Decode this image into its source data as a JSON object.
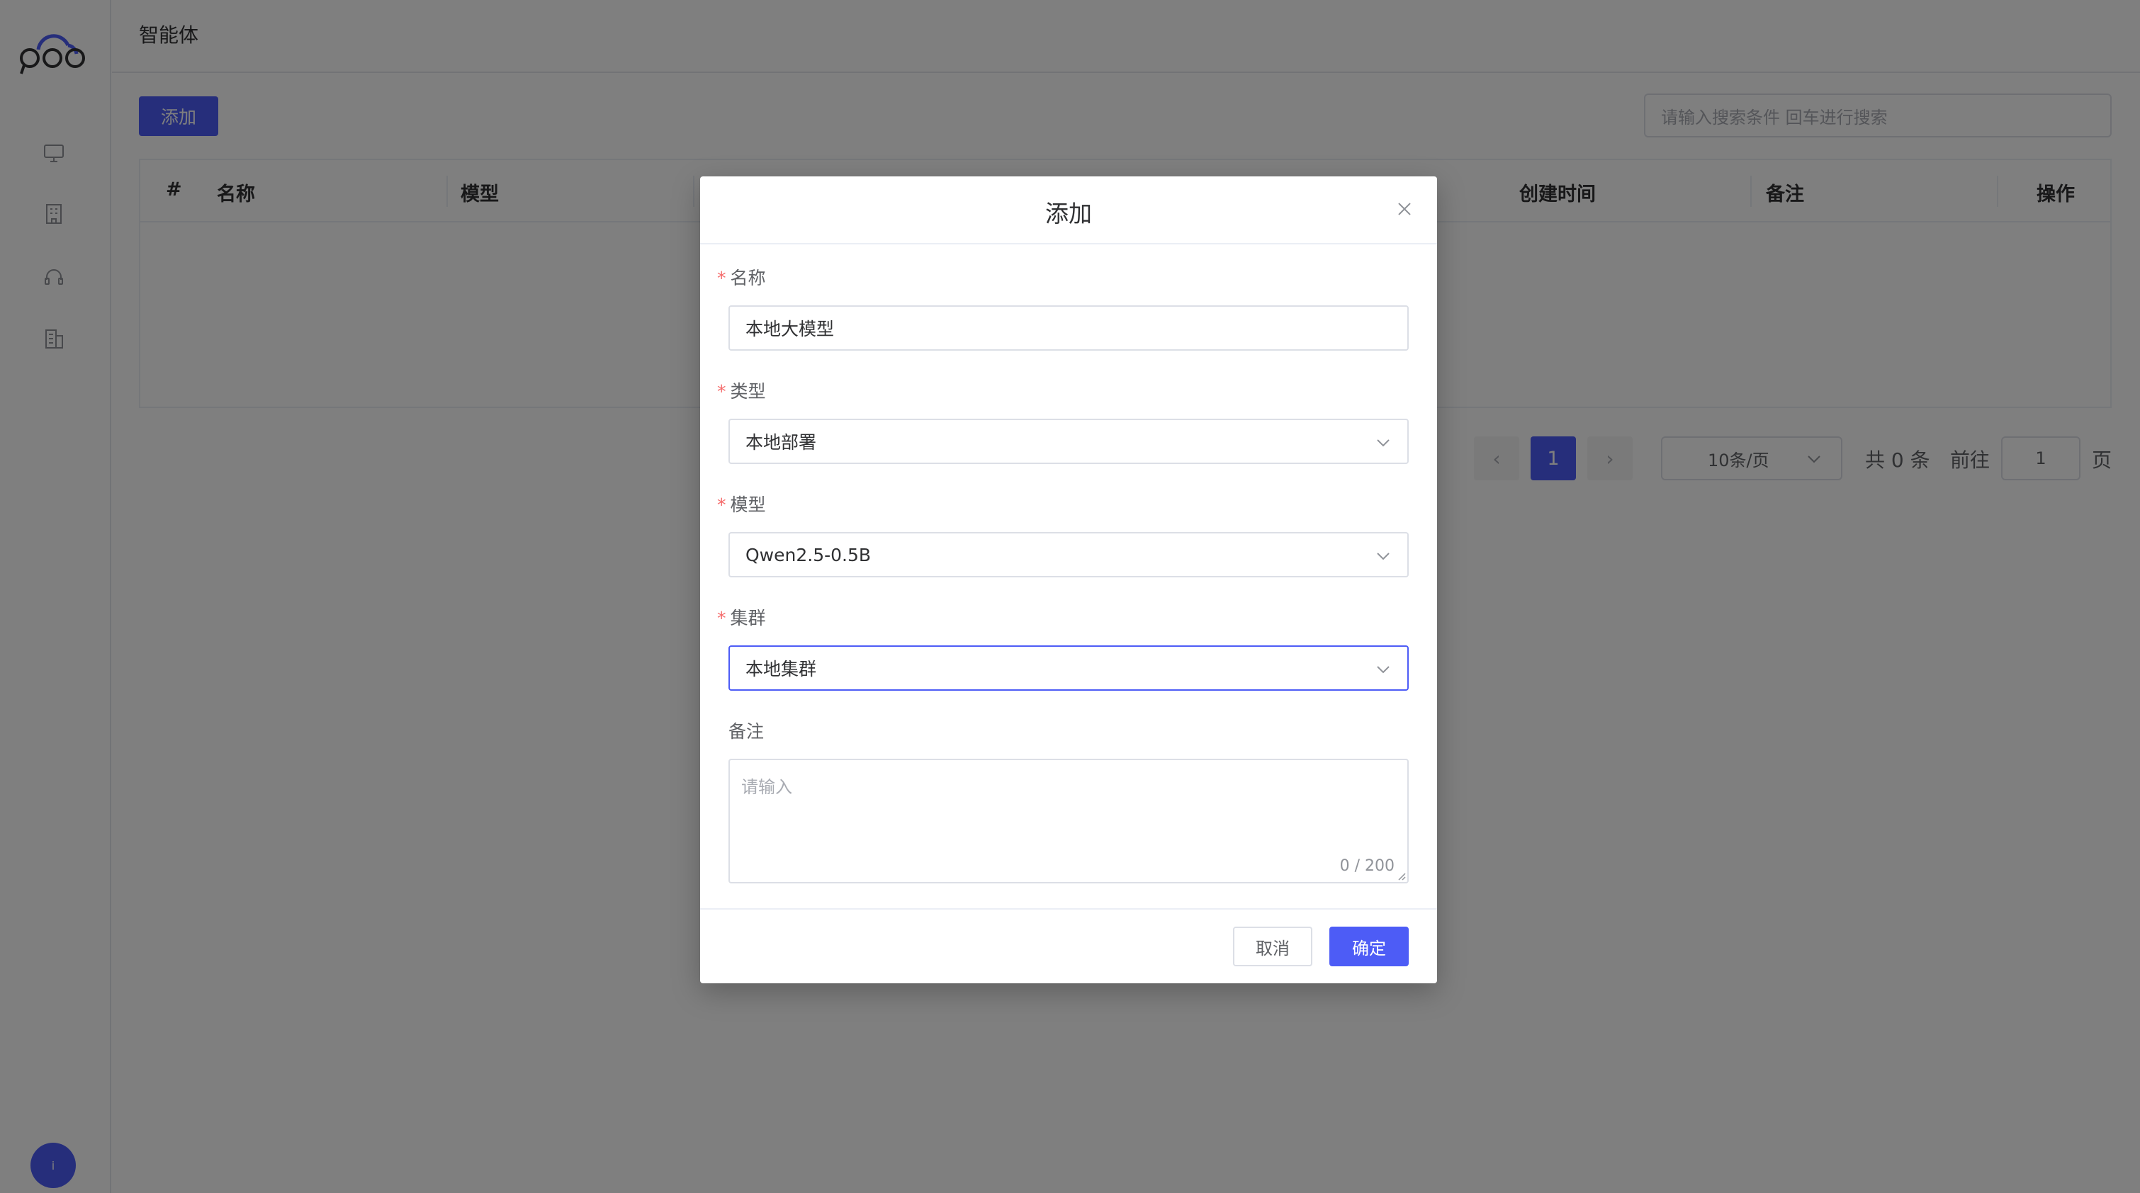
{
  "header": {
    "title": "智能体"
  },
  "sidebar": {
    "items": [
      {
        "icon": "monitor-icon"
      },
      {
        "icon": "building-icon"
      },
      {
        "icon": "headset-icon"
      },
      {
        "icon": "office-icon"
      }
    ],
    "avatar_text": "i"
  },
  "toolbar": {
    "add_label": "添加",
    "search_placeholder": "请输入搜索条件 回车进行搜索"
  },
  "table": {
    "columns": [
      "#",
      "名称",
      "模型",
      "创建时间",
      "备注",
      "操作"
    ],
    "rows": []
  },
  "pagination": {
    "prev": "‹",
    "current_page": "1",
    "next": "›",
    "page_size": "10条/页",
    "total": "共 0 条",
    "goto_label": "前往",
    "goto_value": "1",
    "page_suffix": "页"
  },
  "dialog": {
    "title": "添加",
    "fields": {
      "name": {
        "label": "名称",
        "value": "本地大模型",
        "required": true
      },
      "type": {
        "label": "类型",
        "value": "本地部署",
        "required": true
      },
      "model": {
        "label": "模型",
        "value": "Qwen2.5-0.5B",
        "required": true
      },
      "cluster": {
        "label": "集群",
        "value": "本地集群",
        "required": true
      },
      "remark": {
        "label": "备注",
        "placeholder": "请输入",
        "counter": "0 / 200"
      }
    },
    "required_mark": "*",
    "cancel_label": "取消",
    "confirm_label": "确定"
  },
  "colors": {
    "primary": "#4d5cf6",
    "required": "#f56c6c",
    "overlay": "rgba(0,0,0,0.5)"
  }
}
